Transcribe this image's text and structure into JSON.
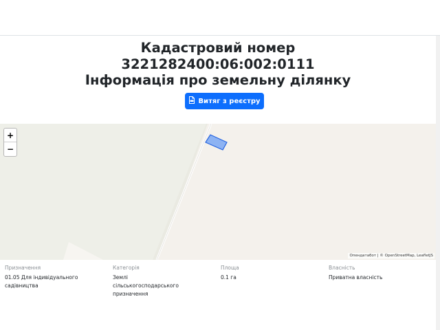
{
  "heading": {
    "line1": "Кадастровий номер",
    "line2": "3221282400:06:002:0111",
    "line3": "Інформація про земельну ділянку"
  },
  "registry_button": {
    "label": "Витяг з реєстру",
    "icon": "file-pdf-icon"
  },
  "map": {
    "zoom_in": "+",
    "zoom_out": "−",
    "attribution": "Опендатабот | © OpenStreetMap, LeafletJS",
    "colors": {
      "land": "#f2efe9",
      "parcel_fill": "#7aa8f5",
      "parcel_stroke": "#2463e0",
      "road": "#ffffff"
    }
  },
  "info": [
    {
      "label": "Призначення",
      "value": "01.05 Для індивідуального садівництва"
    },
    {
      "label": "Категорія",
      "value": "Землі сільськогосподарського призначення"
    },
    {
      "label": "Площа",
      "value": "0.1 га"
    },
    {
      "label": "Власність",
      "value": "Приватна власність"
    }
  ]
}
